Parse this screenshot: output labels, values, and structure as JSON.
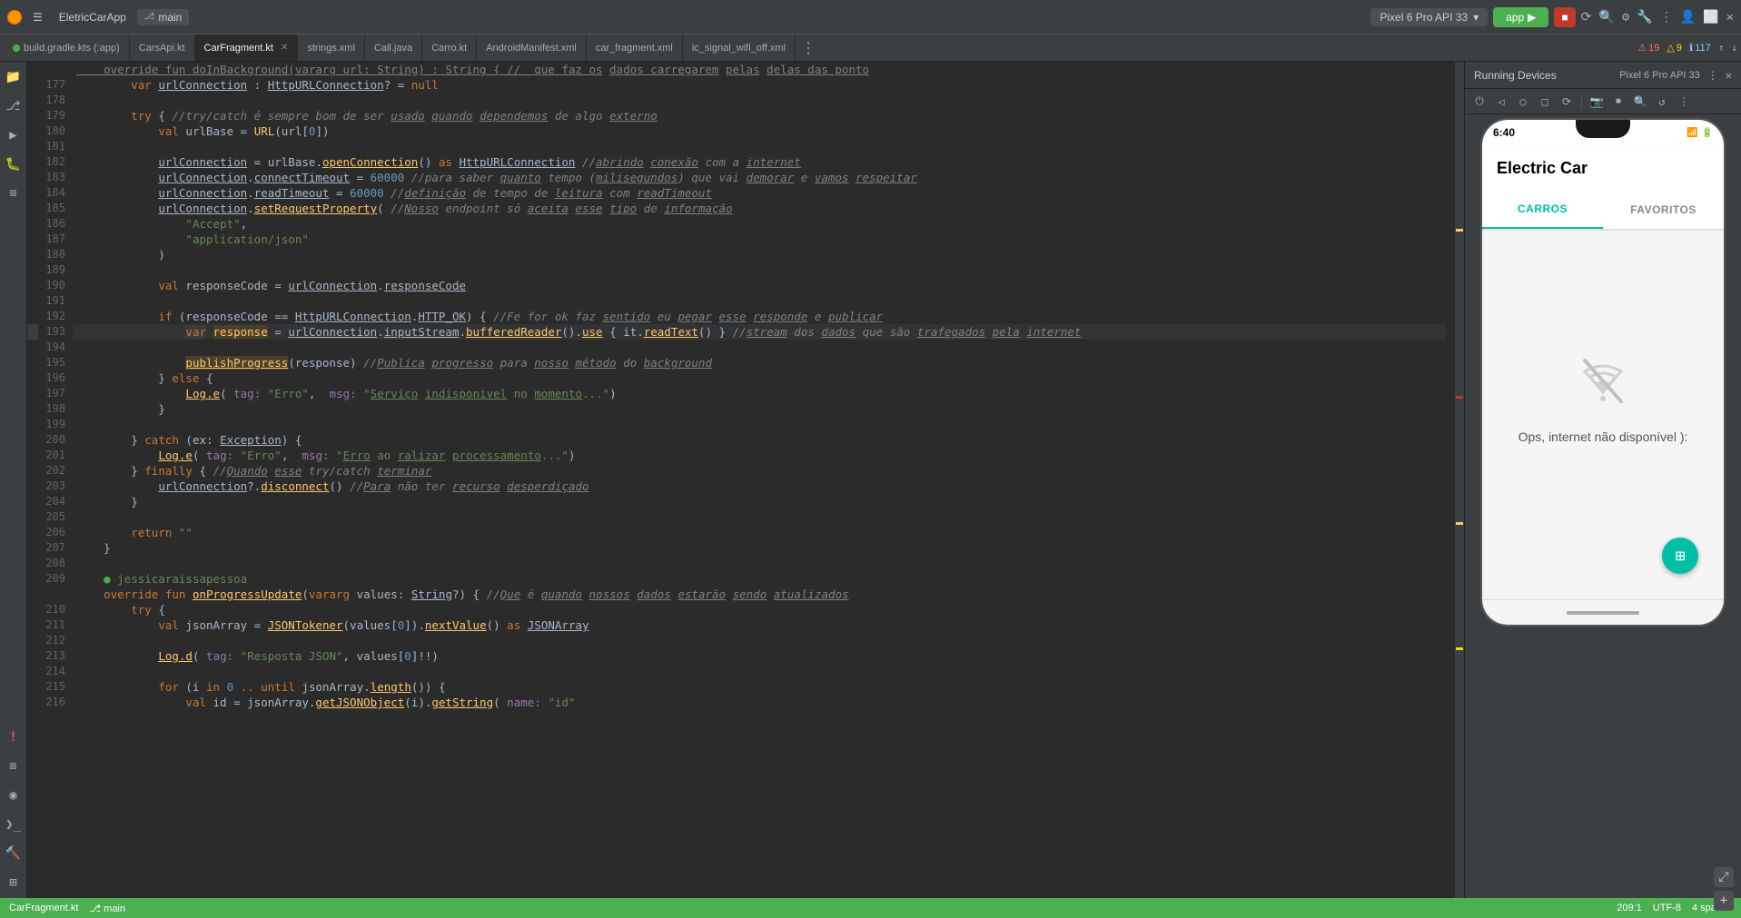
{
  "topbar": {
    "logo": "android-studio-logo",
    "app_name": "EletricCarApp",
    "branch": "main",
    "device": "Pixel 6 Pro API 33",
    "run_label": "app",
    "run_icon": "▶",
    "stop_icon": "■"
  },
  "tabs": [
    {
      "label": "build.gradle.kts (:app)",
      "color": "#4CAF50",
      "active": false,
      "closeable": false
    },
    {
      "label": "CarsApi.kt",
      "color": "#a9b7c6",
      "active": false,
      "closeable": false
    },
    {
      "label": "CarFragment.kt",
      "color": "#a9b7c6",
      "active": true,
      "closeable": true
    },
    {
      "label": "strings.xml",
      "color": "#a9b7c6",
      "active": false,
      "closeable": false
    },
    {
      "label": "Call.java",
      "color": "#a9b7c6",
      "active": false,
      "closeable": false
    },
    {
      "label": "Carro.kt",
      "color": "#a9b7c6",
      "active": false,
      "closeable": false
    },
    {
      "label": "AndroidManifest.xml",
      "color": "#a9b7c6",
      "active": false,
      "closeable": false
    },
    {
      "label": "car_fragment.xml",
      "color": "#a9b7c6",
      "active": false,
      "closeable": false
    },
    {
      "label": "ic_signal_wifi_off.xml",
      "color": "#a9b7c6",
      "active": false,
      "closeable": false
    }
  ],
  "running_panel": {
    "title": "Running Devices",
    "device": "Pixel 6 Pro API 33",
    "close_icon": "✕"
  },
  "phone": {
    "time": "6:40",
    "app_title": "Electric Car",
    "tab_carros": "CARROS",
    "tab_favoritos": "FAVORITOS",
    "active_tab": "CARROS",
    "no_internet_msg": "Ops, internet não disponível ):",
    "fab_icon": "⊞"
  },
  "warnings": {
    "error_count": "19",
    "warn_count": "9",
    "info_count": "117"
  },
  "code_lines": [
    {
      "num": "",
      "code": "    override fun doInBackground(vararg url: String) : String { //  "
    },
    {
      "num": "177",
      "code": "        var urlConnection : HttpURLConnection? = null"
    },
    {
      "num": "178",
      "code": ""
    },
    {
      "num": "179",
      "code": "        try { //try/catch é sempre bom de ser usado quando dependemos de algo externo"
    },
    {
      "num": "180",
      "code": "            val urlBase = URL(url[0])"
    },
    {
      "num": "181",
      "code": ""
    },
    {
      "num": "182",
      "code": "            urlConnection = urlBase.openConnection() as HttpURLConnection //abrindo conexão com a internet"
    },
    {
      "num": "183",
      "code": "            urlConnection.connectTimeout = 60000 //para saber quanto tempo (milisegundos) que vai demorar e vamos respeitar"
    },
    {
      "num": "184",
      "code": "            urlConnection.readTimeout = 60000 //definição de tempo de leitura com readTimeout"
    },
    {
      "num": "185",
      "code": "            urlConnection.setRequestProperty( //Nosso endpoint só aceita esse tipo de informação"
    },
    {
      "num": "186",
      "code": "                \"Accept\","
    },
    {
      "num": "187",
      "code": "                \"application/json\""
    },
    {
      "num": "188",
      "code": "            )"
    },
    {
      "num": "189",
      "code": ""
    },
    {
      "num": "190",
      "code": "            val responseCode = urlConnection.responseCode"
    },
    {
      "num": "191",
      "code": ""
    },
    {
      "num": "192",
      "code": "            if (responseCode == HttpURLConnection.HTTP_OK) { //Fe for ok faz sentido eu pegar esse responde e publicar"
    },
    {
      "num": "193",
      "code": "                var response = urlConnection.inputStream.bufferedReader().use { it.readText() } //stream dos dados que são trafegados pela internet"
    },
    {
      "num": "194",
      "code": ""
    },
    {
      "num": "195",
      "code": "                publishProgress(response) //Publica progresso para nosso método do background"
    },
    {
      "num": "196",
      "code": "            } else {"
    },
    {
      "num": "197",
      "code": "                Log.e( tag: \"Erro\",  msg: \"Serviço indisponivel no momento...\")"
    },
    {
      "num": "198",
      "code": "            }"
    },
    {
      "num": "199",
      "code": ""
    },
    {
      "num": "200",
      "code": "        } catch (ex: Exception) {"
    },
    {
      "num": "201",
      "code": "            Log.e( tag: \"Erro\",  msg: \"Erro ao ralizar processamento...\")"
    },
    {
      "num": "202",
      "code": "        } finally { //Quando esse try/catch terminar"
    },
    {
      "num": "203",
      "code": "            urlConnection?.disconnect() //Para não ter recurso desperdiçado"
    },
    {
      "num": "204",
      "code": "        }"
    },
    {
      "num": "205",
      "code": ""
    },
    {
      "num": "206",
      "code": "        return \"\""
    },
    {
      "num": "207",
      "code": "    }"
    },
    {
      "num": "208",
      "code": ""
    },
    {
      "num": "209",
      "code": "    ●  jessicaraissapessoa"
    },
    {
      "num": "",
      "code": "    override fun onProgressUpdate(vararg values: String?) { //Que é quando nossos dados estarão sendo atualizados"
    },
    {
      "num": "210",
      "code": "        try {"
    },
    {
      "num": "211",
      "code": "            val jsonArray = JSONTokener(values[0]).nextValue() as JSONArray"
    },
    {
      "num": "212",
      "code": ""
    },
    {
      "num": "213",
      "code": "            Log.d( tag: \"Resposta JSON\", values[0]!!)"
    },
    {
      "num": "214",
      "code": ""
    },
    {
      "num": "215",
      "code": "            for (i in 0 .. until jsonArray.length()) {"
    },
    {
      "num": "216",
      "code": "                val id = jsonArray.getJSONObject(i).getString( name: \"id\""
    }
  ]
}
